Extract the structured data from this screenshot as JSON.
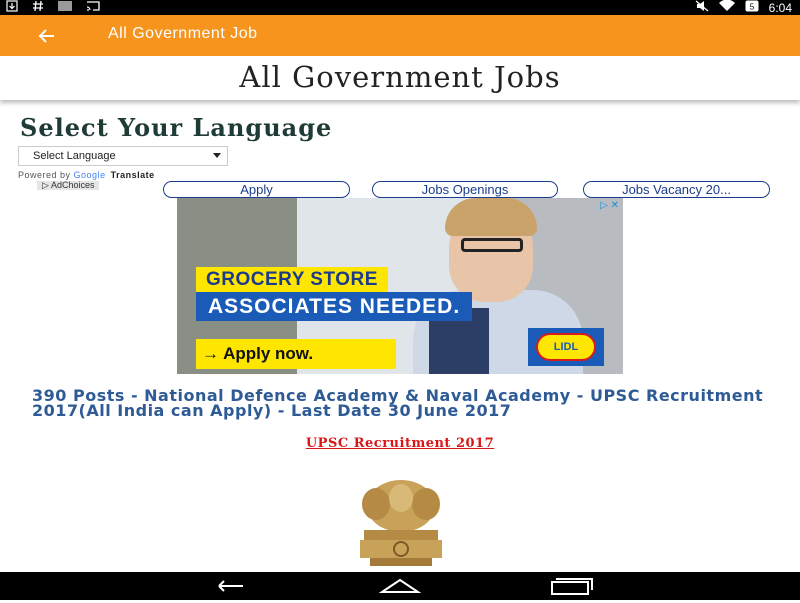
{
  "status_bar": {
    "icons_left": [
      "download-icon",
      "hashtag-icon",
      "barcode-icon",
      "cast-icon"
    ],
    "icons_right": [
      "mute-icon",
      "wifi-icon",
      "battery-icon"
    ],
    "battery_level": "5",
    "time": "6:04"
  },
  "toolbar": {
    "title": "All Government Job",
    "back_icon": "arrow-back-icon",
    "background": "#f7941d"
  },
  "page": {
    "title": "All Government Jobs",
    "language_heading": "Select Your Language",
    "language_select": "Select Language",
    "powered_by": "Powered by",
    "google": "Google",
    "translate": "Translate",
    "adchoices": "AdChoices"
  },
  "link_pills": [
    {
      "label": "Apply"
    },
    {
      "label": "Jobs Openings"
    },
    {
      "label": "Jobs Vacancy 20..."
    }
  ],
  "ad": {
    "headline1": "GROCERY STORE",
    "headline2": "ASSOCIATES NEEDED.",
    "cta": "→ Apply now.",
    "brand": "LIDL",
    "controls": "▷ ✕"
  },
  "article": {
    "title": "390 Posts - National Defence Academy & Naval Academy - UPSC Recruitment 2017(All India can Apply) - Last Date 30 June 2017",
    "sub_link": "UPSC Recruitment 2017",
    "link_color": "#d81818",
    "title_color": "#2e5a96"
  },
  "nav_bar": {
    "buttons": [
      "back-nav-icon",
      "home-nav-icon",
      "recents-nav-icon"
    ]
  }
}
